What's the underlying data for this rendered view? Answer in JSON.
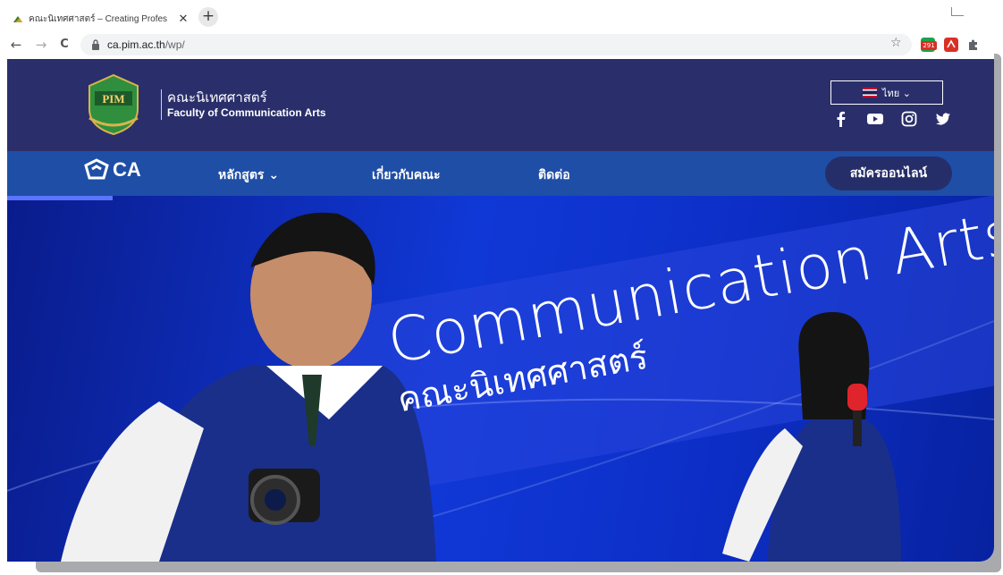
{
  "browser": {
    "tab_title": "คณะนิเทศศาสตร์ – Creating Profes",
    "close_glyph": "✕",
    "new_tab_glyph": "+",
    "back_glyph": "←",
    "forward_glyph": "→",
    "reload_glyph": "C",
    "url_host": "ca.pim.ac.th",
    "url_path": "/wp/",
    "bookmark_glyph": "☆",
    "ext_badge": "291"
  },
  "header": {
    "faculty_th": "คณะนิเทศศาสตร์",
    "faculty_en": "Faculty of Communication Arts",
    "logo_text": "PIM",
    "lang_label": "ไทย ⌄",
    "social_icons": [
      "facebook-icon",
      "youtube-icon",
      "instagram-icon",
      "twitter-icon"
    ]
  },
  "nav": {
    "ca_label": "CA",
    "items": [
      "หลักสูตร ⌄",
      "เกี่ยวกับคณะ",
      "ติดต่อ"
    ],
    "apply_label": "สมัครออนไลน์"
  },
  "hero": {
    "title_en": "Communication Arts",
    "title_th": "คณะนิเทศศาสตร์"
  },
  "colors": {
    "header_bg": "#2a2f6b",
    "nav_bg": "#1f4ea6",
    "apply_bg": "#262e6a",
    "hero_bg": "#1038d6"
  }
}
